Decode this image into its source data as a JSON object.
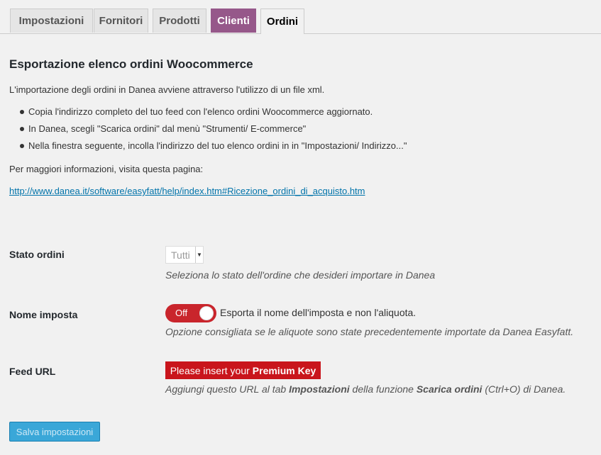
{
  "tabs": [
    {
      "label": "Impostazioni"
    },
    {
      "label": "Fornitori"
    },
    {
      "label": "Prodotti"
    },
    {
      "label": "Clienti"
    },
    {
      "label": "Ordini"
    }
  ],
  "page": {
    "title": "Esportazione elenco ordini Woocommerce",
    "intro": "L'importazione degli ordini in Danea avviene attraverso l'utilizzo di un file xml.",
    "steps": [
      "Copia l'indirizzo completo del tuo feed con l'elenco ordini Woocommerce aggiornato.",
      "In Danea, scegli \"Scarica ordini\" dal menù \"Strumenti/ E-commerce\"",
      "Nella finestra seguente, incolla l'indirizzo del tuo elenco ordini in in \"Impostazioni/ Indirizzo...\""
    ],
    "more_info": "Per maggiori informazioni, visita questa pagina:",
    "link": "http://www.danea.it/software/easyfatt/help/index.htm#Ricezione_ordini_di_acquisto.htm"
  },
  "stato_ordini": {
    "label": "Stato ordini",
    "value": "Tutti",
    "description": "Seleziona lo stato dell'ordine che desideri importare in Danea"
  },
  "nome_imposta": {
    "label": "Nome imposta",
    "toggle_state": "Off",
    "toggle_text": "Esporta il nome dell'imposta e non l'aliquota.",
    "description": "Opzione consigliata se le aliquote sono state precedentemente importate da Danea Easyfatt."
  },
  "feed_url": {
    "label": "Feed URL",
    "premium_prefix": "Please insert your",
    "premium_bold": "Premium Key",
    "desc_1": "Aggiungi questo URL al tab",
    "desc_tab": "Impostazioni",
    "desc_2": "della funzione",
    "desc_func": "Scarica ordini",
    "desc_3": "(Ctrl+O) di Danea."
  },
  "save_label": "Salva impostazioni",
  "colors": {
    "clienti_tab": "#96588a",
    "toggle_off": "#c9252c",
    "premium_bg": "#c9151c",
    "save_button": "#3aa7d8",
    "link": "#0073aa"
  }
}
